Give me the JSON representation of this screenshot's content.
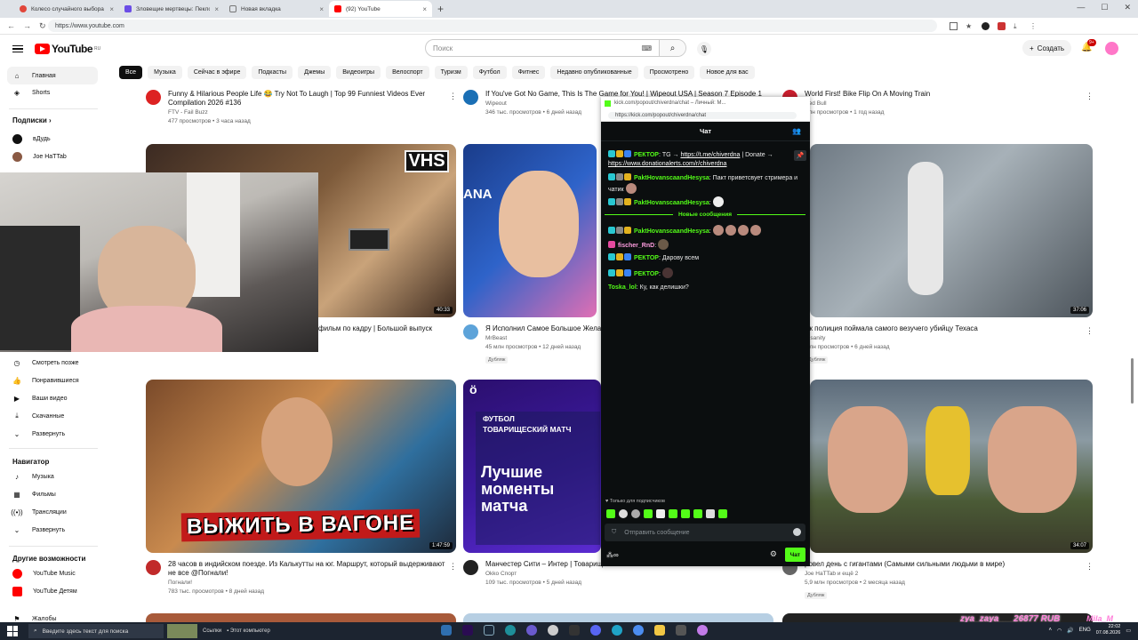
{
  "browser": {
    "tabs": [
      {
        "title": "Колесо случайного выбора – Ра..."
      },
      {
        "title": "Зловещие мертвецы: Пекло (202..."
      },
      {
        "title": "Новая вкладка"
      },
      {
        "title": "(92) YouTube"
      }
    ],
    "new_tab": "+",
    "url": "https://www.youtube.com"
  },
  "youtube": {
    "logo": "YouTube",
    "region": "RU",
    "search_placeholder": "Поиск",
    "create_label": "Создать",
    "notif_count": "9+",
    "chips": [
      "Все",
      "Музыка",
      "Сейчас в эфире",
      "Подкасты",
      "Джемы",
      "Видеоигры",
      "Велоспорт",
      "Туризм",
      "Футбол",
      "Фитнес",
      "Недавно опубликованные",
      "Просмотрено",
      "Новое для вас"
    ],
    "sidebar": {
      "home": "Главная",
      "shorts": "Shorts",
      "subs_header": "Подписки",
      "subs": [
        "вДудь",
        "Joe HaTTab"
      ],
      "you": [
        "Смотреть позже",
        "Понравившиеся",
        "Ваши видео",
        "Скачанные",
        "Развернуть"
      ],
      "navigator_header": "Навигатор",
      "navigator": [
        "Музыка",
        "Фильмы",
        "Трансляции",
        "Развернуть"
      ],
      "other_header": "Другие возможности",
      "other": [
        "YouTube Music",
        "YouTube Детям"
      ],
      "last": "Жалобы"
    },
    "row0": [
      {
        "title": "Funny & Hilarious People Life 😂 Try Not To Laugh | Top 99 Funniest Videos Ever Compilation 2026 #136",
        "channel": "FTV - Fail Buzz",
        "meta": "477 просмотров • 3 часа назад"
      },
      {
        "title": "If You've Got No Game, This Is The Game for You! | Wipeout USA | Season 7 Episode 1",
        "channel": "Wipeout",
        "meta": "346 тыс. просмотров • 6 дней назад"
      },
      {
        "title": "World First! Bike Flip On A Moving Train",
        "channel": "Red Bull",
        "meta": "млн просмотров • 1 год назад"
      }
    ],
    "row1": [
      {
        "title": "фильм по кадру | Большой выпуск",
        "duration": "40:33",
        "thumb_text": "VHS"
      },
      {
        "title": "Я Исполнил Самое Большое Жела...",
        "channel": "MrBeast",
        "meta": "45 млн просмотров • 12 дней назад",
        "dub": "Дубляж",
        "thumb_text": "ANA"
      },
      {
        "title": "ак полиция поймала самого везучего убийцу Техаса",
        "channel": "Insanity",
        "meta": "млн просмотров • 6 дней назад",
        "dub": "Дубляж",
        "duration": "37:06"
      }
    ],
    "row2": [
      {
        "title": "28 часов в индийском поезде. Из Калькутты на юг. Маршрут, который выдерживают не все @Погнали!",
        "channel": "Погнали!",
        "meta": "783 тыс. просмотров • 8 дней назад",
        "duration": "1:47:59",
        "thumb_text": "ВЫЖИТЬ В ВАГОНЕ"
      },
      {
        "title": "Манчестер Сити – Интер | Товарищ...",
        "channel": "Okko Спорт",
        "meta": "109 тыс. просмотров • 5 дней назад",
        "thumb_kicker": "ФУТБОЛ\nТОВАРИЩЕСКИЙ МАТЧ",
        "thumb_text": "Лучшие моменты матча",
        "thumb_logo": "ö"
      },
      {
        "title": "ровел день с гигантами (Самыми сильными людьми в мире)",
        "channel": "Joe HaTTab",
        "channel_extra": "и ещё 2",
        "meta": "5,9 млн просмотров • 2 месяца назад",
        "dub": "Дубляж",
        "duration": "34:07"
      }
    ]
  },
  "chat": {
    "window_title": "kick.com/popout/chiverdna/chat – Личный: M...",
    "url": "https://kick.com/popout/chiverdna/chat",
    "header": "Чат",
    "messages": [
      {
        "user": "РЕКТОР",
        "color": "#53fc18",
        "text": ": TG → ",
        "link1": "https://t.me/chiverdna",
        "text2": " | Donate → ",
        "link2": "https://www.donationalerts.com/r/chiverdna"
      },
      {
        "user": "PaktHovanscaandHesysa",
        "color": "#53fc18",
        "text": ": Пакт приветсвует стримера и чатик"
      },
      {
        "user": "PaktHovanscaandHesysa",
        "color": "#53fc18",
        "text": ":"
      },
      {
        "user": "PaktHovanscaandHesysa",
        "color": "#53fc18",
        "text": ":"
      },
      {
        "user": "fischer_RnD",
        "color": "#ff9de0",
        "text": ":"
      },
      {
        "user": "РЕКТОР",
        "color": "#53fc18",
        "text": ": Дарову всем"
      },
      {
        "user": "РЕКТОР",
        "color": "#53fc18",
        "text": ":"
      },
      {
        "user": "Toska_lol",
        "color": "#53fc18",
        "text": ": Ку, как делишки?"
      }
    ],
    "new_messages": "Новые сообщения",
    "sub_only": "Только для подписчиков",
    "input_placeholder": "Отправить сообщение",
    "send_label": "Чат",
    "infinity": "∞"
  },
  "overlay": {
    "donation": "zya_zaya___26877 RUB",
    "donation2": "Mila_M"
  },
  "taskbar": {
    "search": "Введите здесь текст для поиска",
    "links": "Ссылки",
    "computer": "Этот компьютер",
    "lang": "ENG",
    "time": "22:02",
    "date": "07.08.2026"
  }
}
